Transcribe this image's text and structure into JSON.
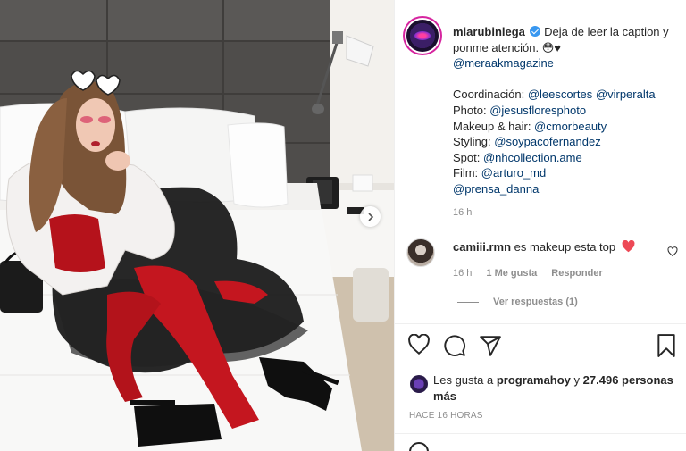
{
  "post": {
    "username": "miarubinlega",
    "verified": true,
    "caption_text": "Deja de leer la caption y ponme atención. 😳♥",
    "caption_mention": "@meraakmagazine",
    "credits": [
      {
        "label": "Coordinación: ",
        "mentions": [
          "@leescortes",
          "@virperalta"
        ]
      },
      {
        "label": "Photo: ",
        "mentions": [
          "@jesusfloresphoto"
        ]
      },
      {
        "label": "Makeup & hair: ",
        "mentions": [
          "@cmorbeauty"
        ]
      },
      {
        "label": "Styling: ",
        "mentions": [
          "@soypacofernandez"
        ]
      },
      {
        "label": "Spot: ",
        "mentions": [
          "@nhcollection.ame"
        ]
      },
      {
        "label": "Film: ",
        "mentions": [
          "@arturo_md"
        ]
      },
      {
        "label": "",
        "mentions": [
          "@prensa_danna"
        ]
      }
    ],
    "caption_time": "16 h"
  },
  "comment": {
    "username": "camiii.rmn",
    "text": "es makeup esta top",
    "time": "16 h",
    "likes": "1 Me gusta",
    "reply": "Responder",
    "view_replies": "Ver respuestas (1)"
  },
  "likes": {
    "prefix": "Les gusta a",
    "user": "programahoy",
    "connector": "y",
    "count": "27.496 personas más"
  },
  "timestamp": "HACE 16 HORAS",
  "icons": [
    "heart-icon",
    "comment-icon",
    "share-icon",
    "bookmark-icon",
    "verified-badge-icon",
    "chevron-right-icon"
  ],
  "colors": {
    "mention": "#00376b",
    "muted": "#8e8e8e",
    "heart_red": "#ed4956",
    "verified": "#3897f0"
  }
}
